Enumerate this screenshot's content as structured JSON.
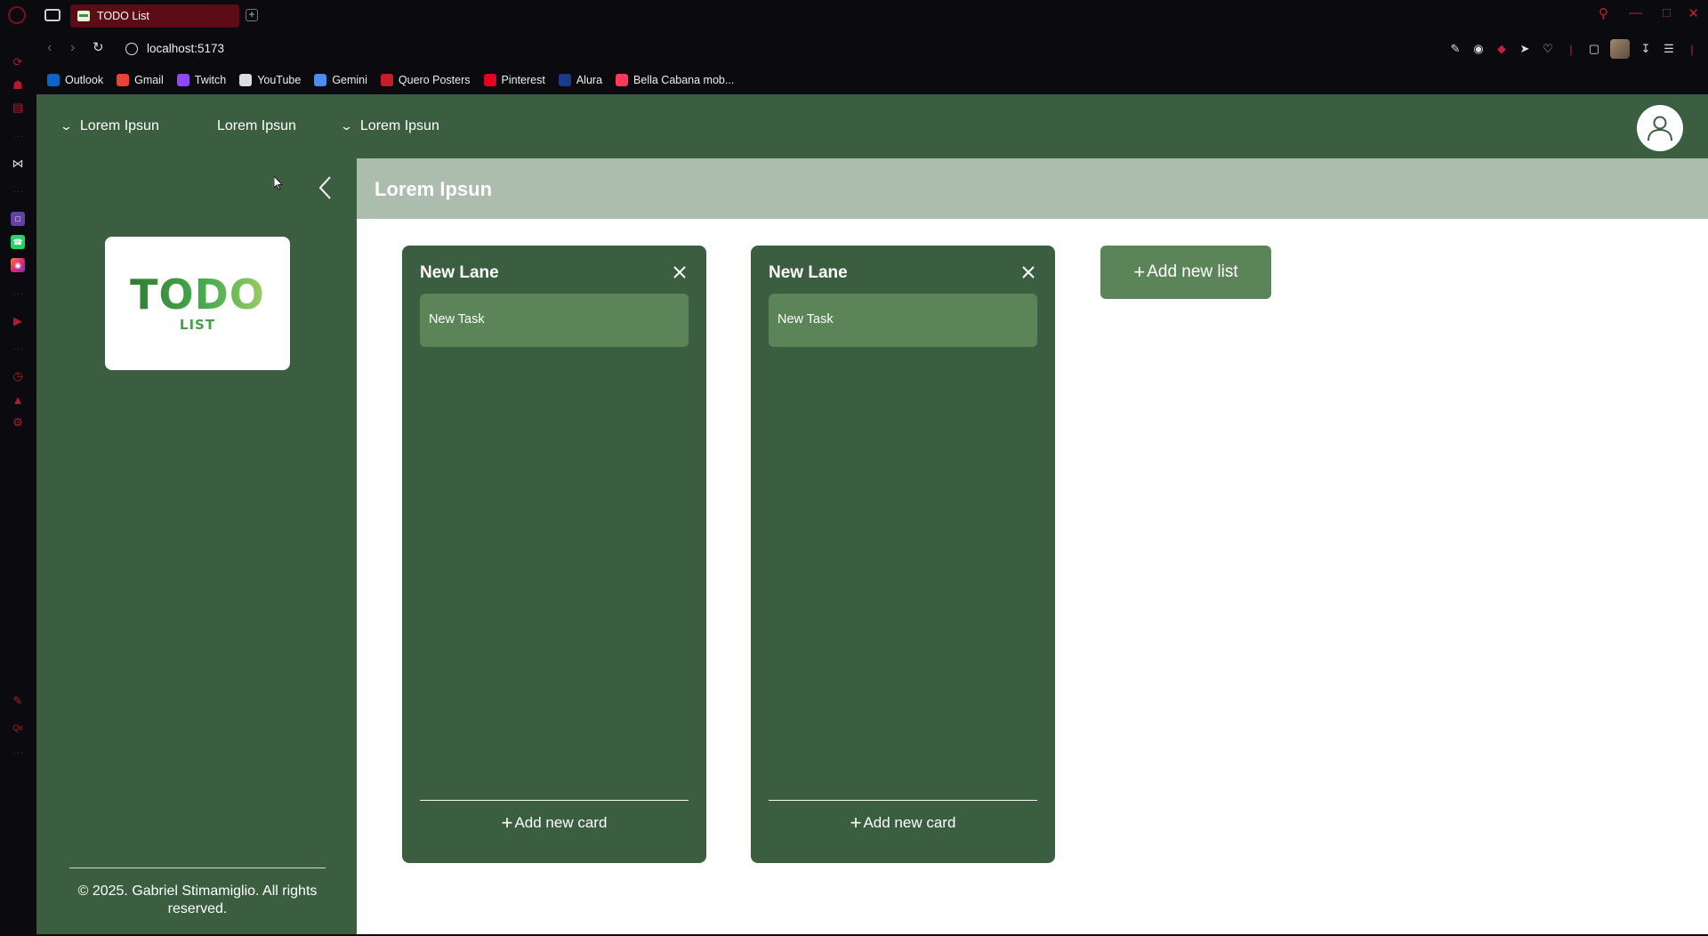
{
  "browser": {
    "tab_title": "TODO List",
    "new_tab_label": "+",
    "url": "localhost:5173",
    "bookmarks": [
      {
        "label": "Outlook",
        "icon": "outlook-icon",
        "color": "#0a64c9"
      },
      {
        "label": "Gmail",
        "icon": "gmail-icon",
        "color": "#ea4335"
      },
      {
        "label": "Twitch",
        "icon": "twitch-icon",
        "color": "#9146ff"
      },
      {
        "label": "YouTube",
        "icon": "document-icon",
        "color": "#dddddd"
      },
      {
        "label": "Gemini",
        "icon": "gemini-icon",
        "color": "#4a8df8"
      },
      {
        "label": "Quero Posters",
        "icon": "quero-posters-icon",
        "color": "#c4202c"
      },
      {
        "label": "Pinterest",
        "icon": "pinterest-icon",
        "color": "#e60023"
      },
      {
        "label": "Alura",
        "icon": "alura-icon",
        "color": "#1a3a8a"
      },
      {
        "label": "Bella Cabana mob...",
        "icon": "airbnb-icon",
        "color": "#ff385c"
      }
    ]
  },
  "header": {
    "menu": [
      {
        "label": "Lorem Ipsun",
        "has_chevron": true
      },
      {
        "label": "Lorem Ipsun",
        "has_chevron": false
      },
      {
        "label": "Lorem Ipsun",
        "has_chevron": true
      }
    ]
  },
  "sidebar": {
    "logo_main": "TODO",
    "logo_sub": "LIST",
    "copyright": "© 2025. Gabriel Stimamiglio. All rights reserved."
  },
  "content": {
    "title": "Lorem Ipsun",
    "lanes": [
      {
        "title": "New Lane",
        "cards": [
          "New Task"
        ],
        "add_card_label": "Add new card"
      },
      {
        "title": "New Lane",
        "cards": [
          "New Task"
        ],
        "add_card_label": "Add new card"
      }
    ],
    "add_list_label": "Add new list"
  },
  "colors": {
    "primary": "#3b5e41",
    "card": "#5b8558",
    "title_bar": "#acbcad",
    "browser_accent": "#c61f33"
  }
}
